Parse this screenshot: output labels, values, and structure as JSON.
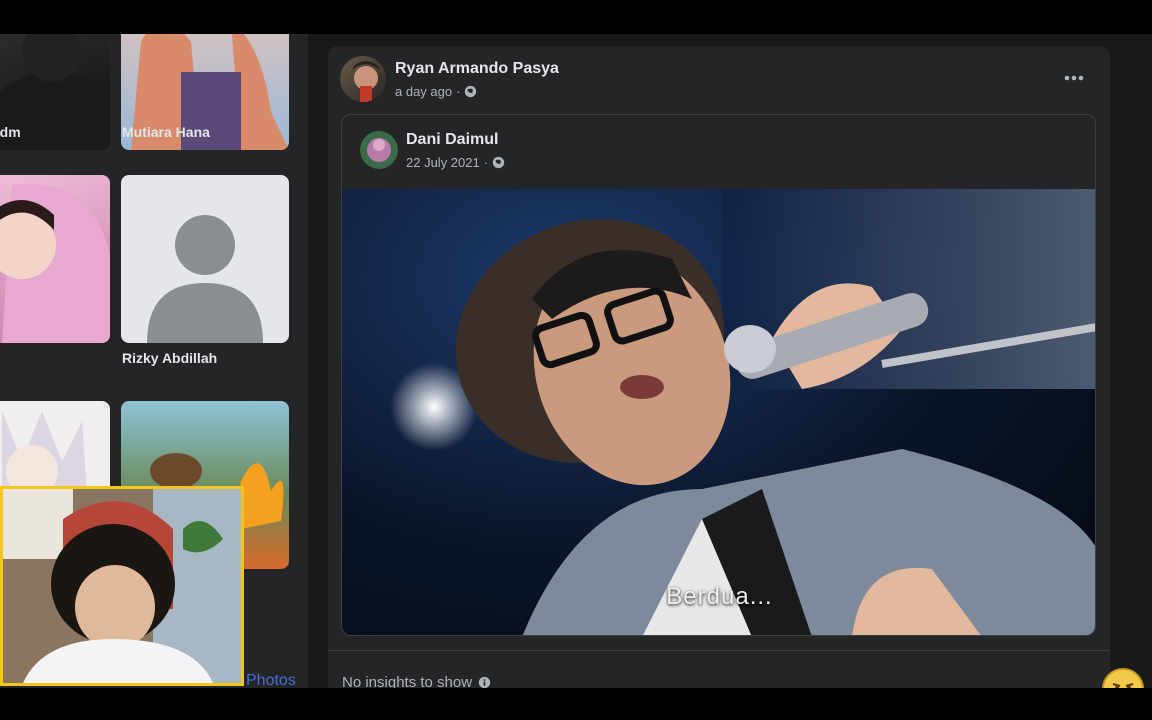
{
  "friends": [
    {
      "name": "...dm"
    },
    {
      "name": "Mutiara Hana"
    },
    {
      "name": "Rizky Abdillah"
    }
  ],
  "post": {
    "author": "Ryan Armando Pasya",
    "time": "a day ago",
    "more_icon": "more-horizontal-icon",
    "shared": {
      "author": "Dani Daimul",
      "date": "22 July 2021",
      "caption": "Berdua..."
    },
    "insights": "No insights to show"
  },
  "photos_link": "Photos",
  "colors": {
    "page_bg": "#18191a",
    "card_bg": "#242526",
    "text": "#e4e6eb",
    "secondary_text": "#b0b3b8",
    "webcam_border": "#f5c518"
  }
}
